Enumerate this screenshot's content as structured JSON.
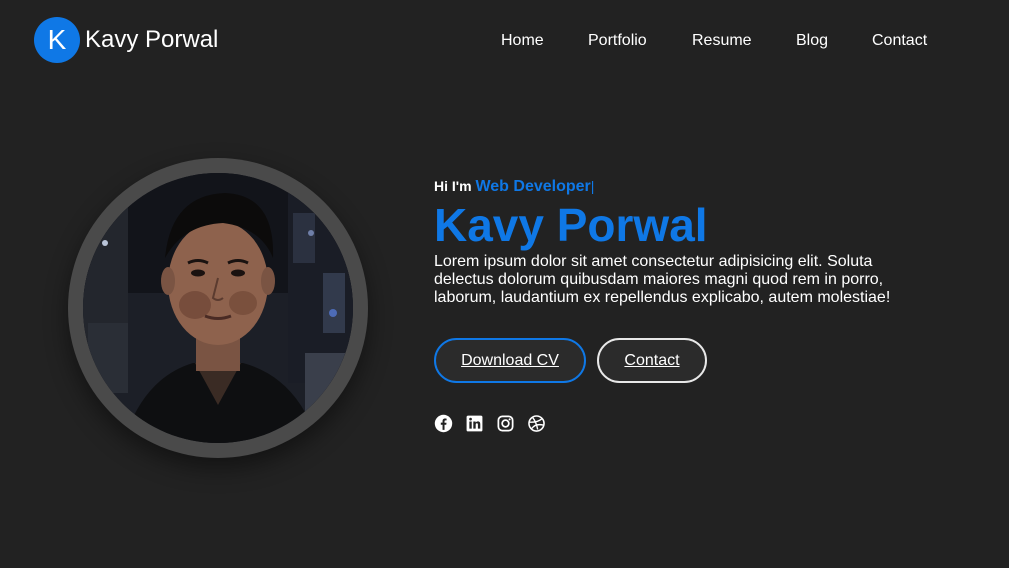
{
  "brand": {
    "initial": "K",
    "name": "Kavy Porwal"
  },
  "nav": {
    "items": [
      {
        "label": "Home"
      },
      {
        "label": "Portfolio"
      },
      {
        "label": "Resume"
      },
      {
        "label": "Blog"
      },
      {
        "label": "Contact"
      }
    ]
  },
  "hero": {
    "greeting": "Hi I'm",
    "role": "Web Developer",
    "caret": "|",
    "name": "Kavy Porwal",
    "description": "Lorem ipsum dolor sit amet consectetur adipisicing elit. Soluta delectus dolorum quibusdam maiores magni quod rem in porro, laborum, laudantium ex repellendus explicabo, autem molestiae!",
    "buttons": {
      "download_cv": "Download CV",
      "contact": "Contact"
    },
    "socials": [
      "facebook-icon",
      "linkedin-icon",
      "instagram-icon",
      "dribbble-icon"
    ]
  },
  "colors": {
    "accent": "#0f78e6",
    "background": "#222222",
    "ring": "#4a4a4a"
  }
}
